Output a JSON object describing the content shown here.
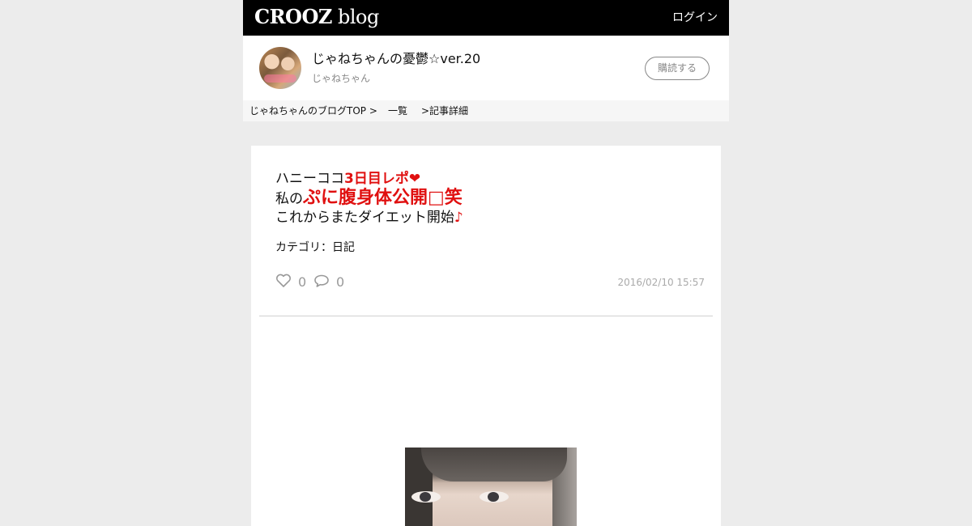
{
  "header": {
    "logo_brand": "CROOZ",
    "logo_suffix": " blog",
    "login_label": "ログイン"
  },
  "blog": {
    "title": "じゃねちゃんの憂鬱☆ver.20",
    "author": "じゃねちゃん",
    "subscribe_label": "購読する"
  },
  "breadcrumb": {
    "top": "じゃねちゃんのブログTOP >",
    "list": "一覧",
    "detail": ">記事詳細"
  },
  "article": {
    "line1_plain": "ハニーココ",
    "line1_red": "3日目レポ❤",
    "line2_plain": "私の",
    "line2_red": "ぷに腹身体公開□笑",
    "line3_plain": "これからまたダイエット開始",
    "line3_red": "♪",
    "category": "カテゴリ：日記",
    "likes": "0",
    "comments": "0",
    "date": "2016/02/10 15:57"
  },
  "colors": {
    "accent_red": "#e01010",
    "topbar": "#000000",
    "page_bg": "#ececec"
  },
  "icons": {
    "like": "heart-icon",
    "comment": "speech-bubble-icon"
  }
}
